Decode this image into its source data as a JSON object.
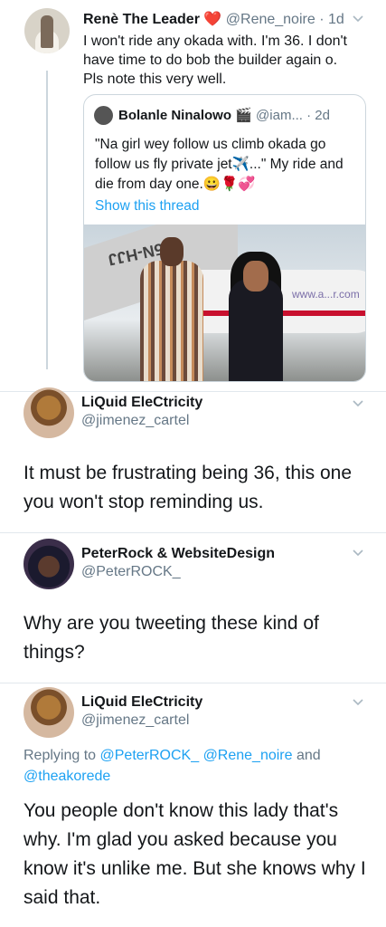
{
  "tweet_main": {
    "name": "Renè The Leader",
    "handle": "@Rene_noire",
    "time": "· 1d",
    "text": "I won't ride any okada with. I'm 36. I don't have time to do bob the builder again o. Pls note this very well."
  },
  "quoted_tweet": {
    "name": "Bolanle Ninalowo",
    "handle": "@iam...",
    "time": "· 2d",
    "text": "\"Na girl wey follow us climb okada go follow us fly private jet✈️...\" My ride and die from day one.😀🌹💞",
    "show_thread": "Show this thread",
    "photo": {
      "plane_registration": "5N-HJJ",
      "website": "www.a...r.com"
    }
  },
  "reply1": {
    "name": "LiQuid EleCtricity",
    "handle": "@jimenez_cartel",
    "text": "It must be frustrating being 36, this one you won't stop reminding us."
  },
  "reply2": {
    "name": "PeterRock & WebsiteDesign",
    "handle": "@PeterROCK_",
    "text": "Why are you tweeting these kind of things?"
  },
  "reply3": {
    "name": "LiQuid EleCtricity",
    "handle": "@jimenez_cartel",
    "replying_prefix": "Replying to ",
    "mention1": "@PeterROCK_",
    "mention2": "@Rene_noire",
    "and_text": " and",
    "mention3": "@theakorede",
    "text": "You people don't know this lady that's why. I'm glad you asked because you know it's unlike me. But she knows why I said that."
  },
  "colors": {
    "link": "#1da1f2",
    "secondary_text": "#657786",
    "heart": "#e0245e",
    "divider": "#e1e8ed"
  }
}
